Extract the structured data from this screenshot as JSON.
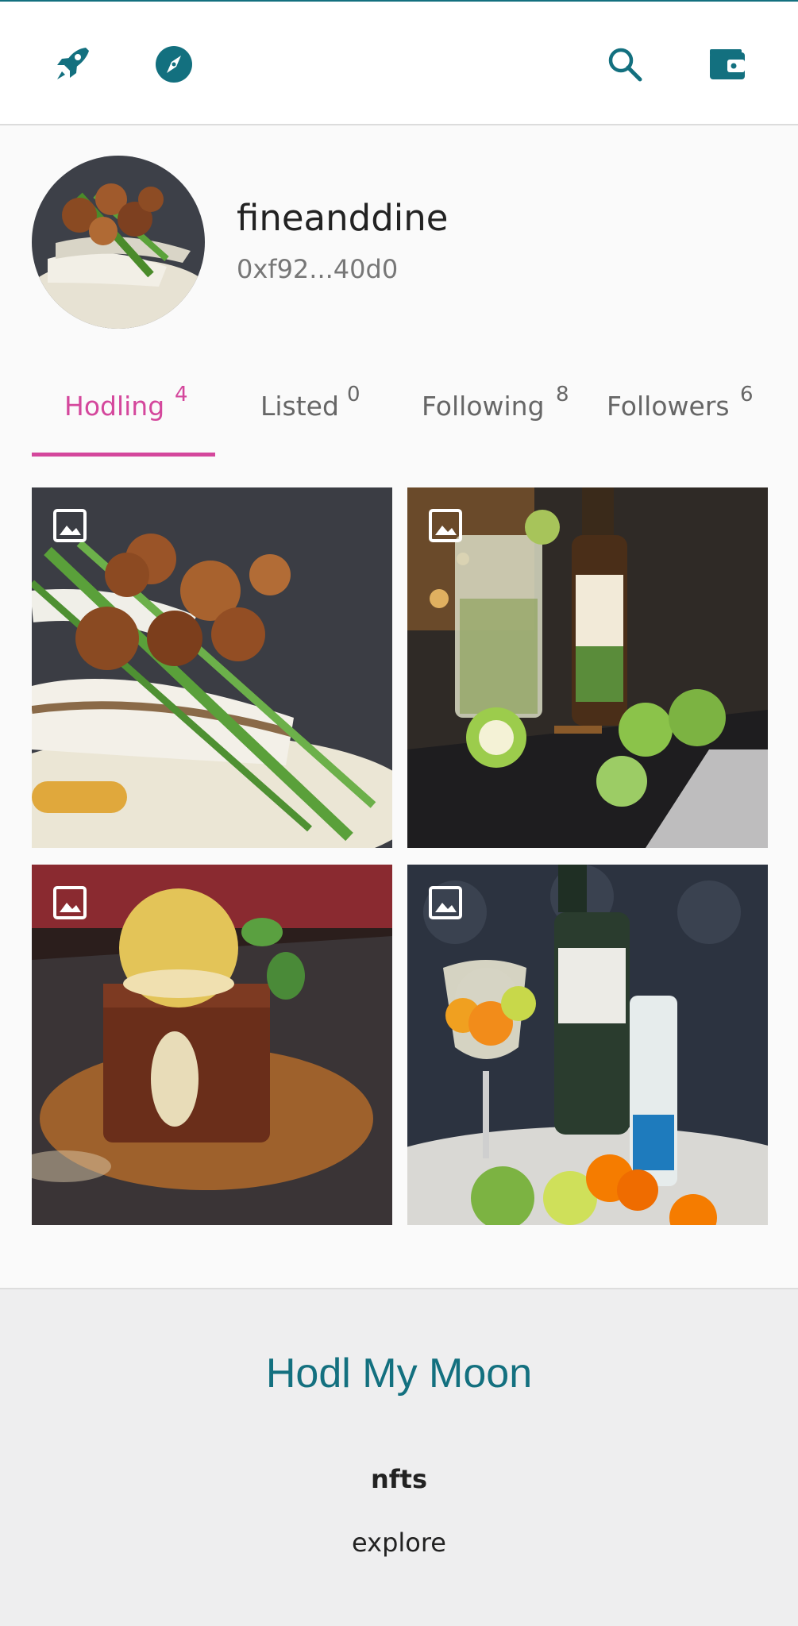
{
  "colors": {
    "accent": "#13707f",
    "active_tab": "#d4479c"
  },
  "topbar": {
    "icons": [
      "rocket-icon",
      "compass-icon",
      "search-icon",
      "wallet-icon"
    ]
  },
  "profile": {
    "username": "fineanddine",
    "address": "0xf92...40d0"
  },
  "tabs": [
    {
      "label": "Hodling",
      "count": "4",
      "active": true
    },
    {
      "label": "Listed",
      "count": "0",
      "active": false
    },
    {
      "label": "Following",
      "count": "8",
      "active": false
    },
    {
      "label": "Followers",
      "count": "6",
      "active": false
    }
  ],
  "nfts": [
    {
      "subject": "fish dish with crisps and spring onion",
      "icon": "image-icon"
    },
    {
      "subject": "apple mojito with Captain Morgan Sliced Apple bottle",
      "icon": "image-icon"
    },
    {
      "subject": "sticky toffee pudding with ice cream",
      "icon": "image-icon"
    },
    {
      "subject": "gin and tonic with Seven Crofts and Fever-Tree",
      "icon": "image-icon"
    }
  ],
  "footer": {
    "brand": "Hodl My Moon",
    "links": [
      "nfts",
      "explore"
    ]
  }
}
